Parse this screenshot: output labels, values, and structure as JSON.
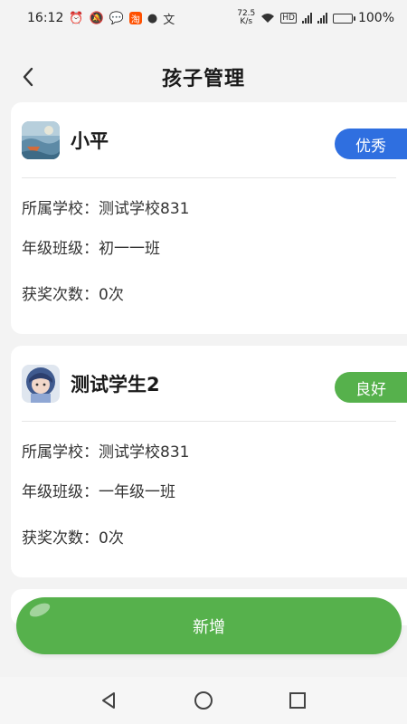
{
  "status_bar": {
    "time": "16:12",
    "net_speed_value": "72.5",
    "net_speed_unit": "K/s",
    "battery": "100%",
    "hd_label": "HD",
    "taobao_label": "淘"
  },
  "header": {
    "title": "孩子管理"
  },
  "children": [
    {
      "name": "小平",
      "badge": "优秀",
      "badge_color": "#2f6fe0",
      "school": "所属学校：测试学校831",
      "class": "年级班级：初一一班",
      "awards": "获奖次数：0次"
    },
    {
      "name": "测试学生2",
      "badge": "良好",
      "badge_color": "#56b14c",
      "school": "所属学校：测试学校831",
      "class": "年级班级：一年级一班",
      "awards": "获奖次数：0次"
    }
  ],
  "add_button": {
    "label": "新增",
    "color": "#56b14c"
  }
}
